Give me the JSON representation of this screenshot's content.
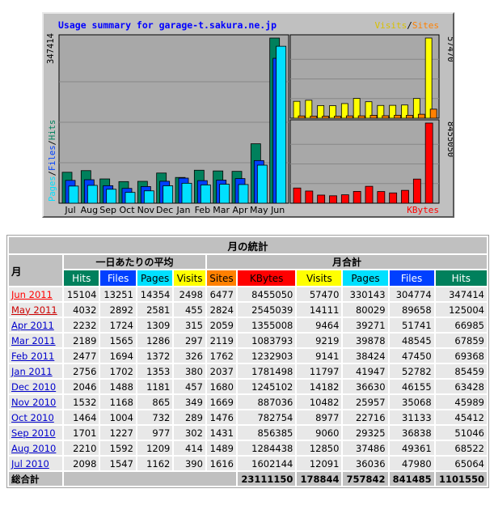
{
  "chart_data": {
    "type": "bar",
    "title": "Usage summary for garage-t.sakura.ne.jp",
    "categories": [
      "Jul",
      "Aug",
      "Sep",
      "Oct",
      "Nov",
      "Dec",
      "Jan",
      "Feb",
      "Mar",
      "Apr",
      "May",
      "Jun"
    ],
    "left_panel": {
      "ylabel": "Pages / Files / Hits",
      "ymax_label": "347414",
      "ymax": 347414,
      "series": [
        {
          "name": "Hits",
          "color": "#00805c",
          "values": [
            65064,
            68522,
            51046,
            45412,
            45989,
            63428,
            54159,
            69368,
            67859,
            66985,
            125004,
            347414
          ]
        },
        {
          "name": "Files",
          "color": "#0040ff",
          "values": [
            47980,
            49361,
            36838,
            31133,
            35068,
            46155,
            52782,
            47450,
            48545,
            51741,
            89658,
            304774
          ]
        },
        {
          "name": "Pages",
          "color": "#00e0ff",
          "values": [
            36036,
            37486,
            29325,
            22716,
            25957,
            36630,
            41947,
            38424,
            39878,
            39271,
            80029,
            330143
          ]
        }
      ]
    },
    "top_right_panel": {
      "ymax_label": "57470",
      "ymax": 57470,
      "legend": [
        "Visits",
        "Sites"
      ],
      "series": [
        {
          "name": "Visits",
          "color": "#ffff00",
          "values": [
            12091,
            12850,
            9060,
            8977,
            10482,
            14182,
            11797,
            9141,
            9219,
            9464,
            14111,
            57470
          ]
        },
        {
          "name": "Sites",
          "color": "#ff8000",
          "values": [
            1616,
            1489,
            1431,
            1476,
            1669,
            1680,
            2037,
            1762,
            2119,
            2059,
            2824,
            6477
          ]
        }
      ]
    },
    "bottom_right_panel": {
      "ymax_label": "8455050",
      "ymax": 8455050,
      "legend": [
        "KBytes"
      ],
      "series": [
        {
          "name": "KBytes",
          "color": "#ff0000",
          "values": [
            1602144,
            1284438,
            856385,
            782754,
            887036,
            1245102,
            1781498,
            1232903,
            1083793,
            1355008,
            2545039,
            8455050
          ]
        }
      ]
    }
  },
  "table": {
    "title": "月の統計",
    "month_header": "月",
    "daily_avg_header": "一日あたりの平均",
    "monthly_total_header": "月合計",
    "daily_columns": [
      "Hits",
      "Files",
      "Pages",
      "Visits"
    ],
    "total_columns": [
      "Sites",
      "KBytes",
      "Visits",
      "Pages",
      "Files",
      "Hits"
    ],
    "rows": [
      {
        "month": "Jun 2011",
        "cells": [
          "15104",
          "13251",
          "14354",
          "2498",
          "6477",
          "8455050",
          "57470",
          "330143",
          "304774",
          "347414"
        ]
      },
      {
        "month": "May 2011",
        "cells": [
          "4032",
          "2892",
          "2581",
          "455",
          "2824",
          "2545039",
          "14111",
          "80029",
          "89658",
          "125004"
        ]
      },
      {
        "month": "Apr 2011",
        "cells": [
          "2232",
          "1724",
          "1309",
          "315",
          "2059",
          "1355008",
          "9464",
          "39271",
          "51741",
          "66985"
        ]
      },
      {
        "month": "Mar 2011",
        "cells": [
          "2189",
          "1565",
          "1286",
          "297",
          "2119",
          "1083793",
          "9219",
          "39878",
          "48545",
          "67859"
        ]
      },
      {
        "month": "Feb 2011",
        "cells": [
          "2477",
          "1694",
          "1372",
          "326",
          "1762",
          "1232903",
          "9141",
          "38424",
          "47450",
          "69368"
        ]
      },
      {
        "month": "Jan 2011",
        "cells": [
          "2756",
          "1702",
          "1353",
          "380",
          "2037",
          "1781498",
          "11797",
          "41947",
          "52782",
          "85459"
        ]
      },
      {
        "month": "Dec 2010",
        "cells": [
          "2046",
          "1488",
          "1181",
          "457",
          "1680",
          "1245102",
          "14182",
          "36630",
          "46155",
          "63428"
        ]
      },
      {
        "month": "Nov 2010",
        "cells": [
          "1532",
          "1168",
          "865",
          "349",
          "1669",
          "887036",
          "10482",
          "25957",
          "35068",
          "45989"
        ]
      },
      {
        "month": "Oct 2010",
        "cells": [
          "1464",
          "1004",
          "732",
          "289",
          "1476",
          "782754",
          "8977",
          "22716",
          "31133",
          "45412"
        ]
      },
      {
        "month": "Sep 2010",
        "cells": [
          "1701",
          "1227",
          "977",
          "302",
          "1431",
          "856385",
          "9060",
          "29325",
          "36838",
          "51046"
        ]
      },
      {
        "month": "Aug 2010",
        "cells": [
          "2210",
          "1592",
          "1209",
          "414",
          "1489",
          "1284438",
          "12850",
          "37486",
          "49361",
          "68522"
        ]
      },
      {
        "month": "Jul 2010",
        "cells": [
          "2098",
          "1547",
          "1162",
          "390",
          "1616",
          "1602144",
          "12091",
          "36036",
          "47980",
          "65064"
        ]
      }
    ],
    "total_label": "総合計",
    "totals": [
      "23111150",
      "178844",
      "757842",
      "841485",
      "1101550"
    ]
  }
}
